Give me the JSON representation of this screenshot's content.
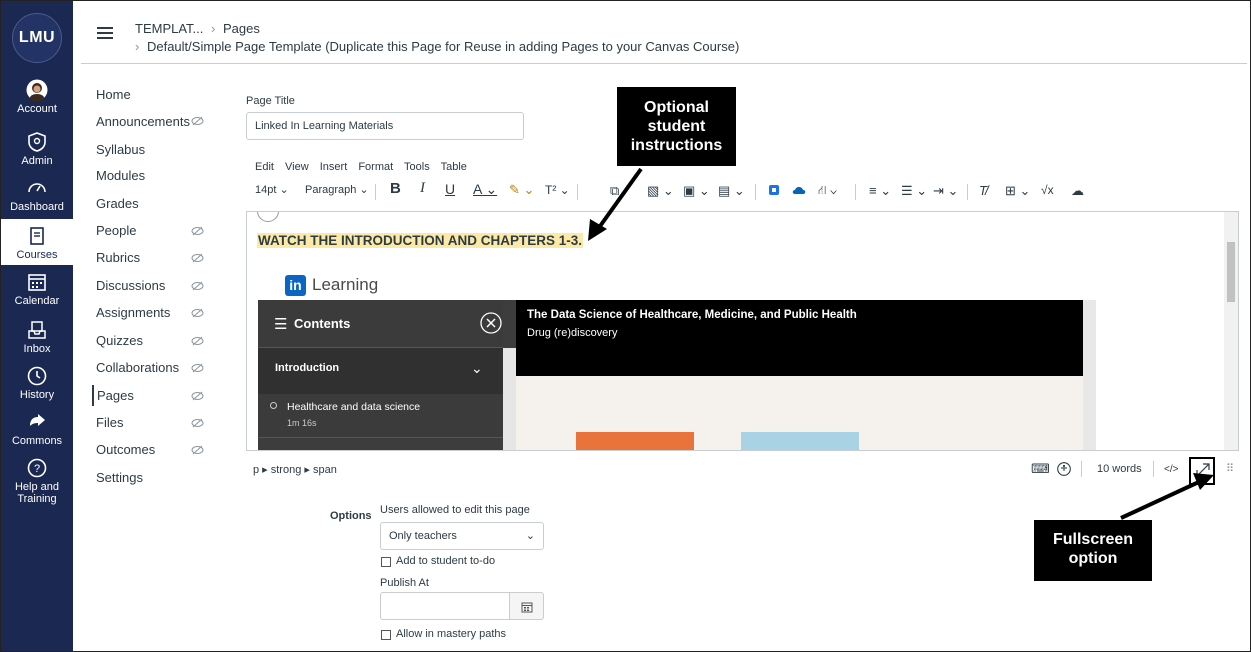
{
  "global_nav": {
    "logo": "LMU",
    "items": [
      {
        "label": "Account",
        "icon": "account-avatar-icon"
      },
      {
        "label": "Admin",
        "icon": "shield-icon"
      },
      {
        "label": "Dashboard",
        "icon": "dashboard-gauge-icon"
      },
      {
        "label": "Courses",
        "icon": "courses-book-icon"
      },
      {
        "label": "Calendar",
        "icon": "calendar-icon"
      },
      {
        "label": "Inbox",
        "icon": "inbox-icon"
      },
      {
        "label": "History",
        "icon": "clock-icon"
      },
      {
        "label": "Commons",
        "icon": "commons-arrow-icon"
      },
      {
        "label": "Help and",
        "label2": "Training",
        "icon": "help-question-icon"
      }
    ]
  },
  "header": {
    "crumb_course": "TEMPLAT...",
    "crumb_sep": "›",
    "crumb_section": "Pages",
    "crumb_page": "Default/Simple Page Template (Duplicate this Page for Reuse in adding Pages to your Canvas Course)"
  },
  "course_nav": {
    "items": [
      {
        "label": "Home",
        "hidden": false
      },
      {
        "label": "Announcements",
        "hidden": true
      },
      {
        "label": "Syllabus",
        "hidden": false
      },
      {
        "label": "Modules",
        "hidden": false
      },
      {
        "label": "Grades",
        "hidden": false
      },
      {
        "label": "People",
        "hidden": true
      },
      {
        "label": "Rubrics",
        "hidden": true
      },
      {
        "label": "Discussions",
        "hidden": true
      },
      {
        "label": "Assignments",
        "hidden": true
      },
      {
        "label": "Quizzes",
        "hidden": true
      },
      {
        "label": "Collaborations",
        "hidden": true
      },
      {
        "label": "Pages",
        "hidden": true,
        "active": true
      },
      {
        "label": "Files",
        "hidden": true
      },
      {
        "label": "Outcomes",
        "hidden": true
      },
      {
        "label": "Settings",
        "hidden": false
      }
    ]
  },
  "editor": {
    "page_title_label": "Page Title",
    "page_title_value": "Linked In Learning Materials",
    "menus": [
      "Edit",
      "View",
      "Insert",
      "Format",
      "Tools",
      "Table"
    ],
    "font_size": "14pt",
    "block_format": "Paragraph",
    "content_heading": "WATCH THE INTRODUCTION AND CHAPTERS 1-3.",
    "brand_name": "Learning",
    "brand_mark": "in",
    "embed": {
      "contents_label": "Contents",
      "section_label": "Introduction",
      "item_label": "Healthcare and data science",
      "item_duration": "1m 16s",
      "course_title": "The Data Science of Healthcare, Medicine, and Public Health",
      "chapter_title": "Drug (re)discovery"
    },
    "status_path": "p ▸ strong ▸ span",
    "word_count": "10 words",
    "html_toggle": "</>"
  },
  "options": {
    "label": "Options",
    "edit_permission_label": "Users allowed to edit this page",
    "edit_permission_value": "Only teachers",
    "todo_label": "Add to student to-do",
    "publish_at_label": "Publish At",
    "mastery_label": "Allow in mastery paths"
  },
  "callouts": {
    "instructions": "Optional student instructions",
    "instructions_lines": [
      "Optional",
      "student",
      "instructions"
    ],
    "fullscreen_lines": [
      "Fullscreen",
      "option"
    ]
  }
}
